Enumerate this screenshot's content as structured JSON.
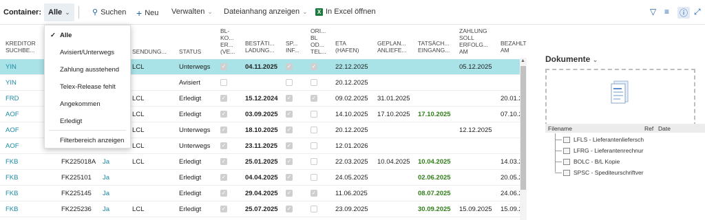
{
  "toolbar": {
    "container_label": "Container:",
    "filter_value": "Alle",
    "search_label": "Suchen",
    "new_label": "Neu",
    "manage_label": "Verwalten",
    "attachment_label": "Dateianhang anzeigen",
    "excel_label": "In Excel öffnen",
    "excel_badge": "X",
    "icons": [
      "filter-icon",
      "list-icon",
      "info-icon",
      "expand-icon"
    ]
  },
  "dropdown": {
    "items": [
      {
        "label": "Alle",
        "checked": true
      },
      {
        "label": "Avisiert/Unterwegs"
      },
      {
        "label": "Zahlung ausstehend"
      },
      {
        "label": "Telex-Release fehlt"
      },
      {
        "label": "Angekommen"
      },
      {
        "label": "Erledigt"
      }
    ],
    "footer": "Filterbereich anzeigen"
  },
  "table": {
    "headers": {
      "kreditor": "KREDITOR\nSUCHBE...",
      "sendung": "SENDUNG...",
      "status": "STATUS",
      "blko": "BL-\nKO...\nER...\n(VE...",
      "bestaet": "BESTÄTI...\nLADUNG...",
      "sp": "SP...\nINF...",
      "ori": "ORI...\nBL\nOD...\nTEL...",
      "eta": "ETA\n(HAFEN)",
      "geplan": "GEPLAN...\nANLIEFE...",
      "tatsaech": "TATSÄCH...\nEINGANG...",
      "zahlung": "ZAHLUNG\nSOLL\nERFOLG...\nAM",
      "bezahlt": "BEZAHLT\nAM"
    },
    "rows": [
      {
        "kreditor": "YIN",
        "ref": "",
        "ja": "",
        "sendung": "LCL",
        "status": "Unterwegs",
        "blko": true,
        "bestaet": "04.11.2025",
        "sp": true,
        "ori": true,
        "eta": "22.12.2025",
        "geplan": "",
        "tatsaech": "",
        "zahlung": "05.12.2025",
        "bezahlt": ""
      },
      {
        "kreditor": "YIN",
        "ref": "",
        "ja": "",
        "sendung": "",
        "status": "Avisiert",
        "blko": false,
        "bestaet": "",
        "sp": false,
        "ori": false,
        "eta": "20.12.2025",
        "geplan": "",
        "tatsaech": "",
        "zahlung": "",
        "bezahlt": ""
      },
      {
        "kreditor": "FRD",
        "ref": "",
        "ja": "",
        "sendung": "LCL",
        "status": "Erledigt",
        "blko": true,
        "bestaet": "15.12.2024",
        "sp": true,
        "ori": true,
        "eta": "09.02.2025",
        "geplan": "31.01.2025",
        "tatsaech": "",
        "zahlung": "",
        "bezahlt": "20.01.2"
      },
      {
        "kreditor": "AOF",
        "ref": "",
        "ja": "",
        "sendung": "LCL",
        "status": "Erledigt",
        "blko": true,
        "bestaet": "03.09.2025",
        "sp": true,
        "ori": false,
        "eta": "14.10.2025",
        "geplan": "17.10.2025",
        "tatsaech": "17.10.2025",
        "zahlung": "",
        "bezahlt": "07.10.2"
      },
      {
        "kreditor": "AOF",
        "ref": "",
        "ja": "",
        "sendung": "LCL",
        "status": "Unterwegs",
        "blko": true,
        "bestaet": "18.10.2025",
        "sp": true,
        "ori": false,
        "eta": "20.12.2025",
        "geplan": "",
        "tatsaech": "",
        "zahlung": "12.12.2025",
        "bezahlt": ""
      },
      {
        "kreditor": "AOF",
        "ref": "",
        "ja": "",
        "sendung": "LCL",
        "status": "Unterwegs",
        "blko": true,
        "bestaet": "23.11.2025",
        "sp": true,
        "ori": false,
        "eta": "12.01.2026",
        "geplan": "",
        "tatsaech": "",
        "zahlung": "",
        "bezahlt": ""
      },
      {
        "kreditor": "FKB",
        "ref": "FK225018A",
        "ja": "Ja",
        "sendung": "LCL",
        "status": "Erledigt",
        "blko": true,
        "bestaet": "25.01.2025",
        "sp": true,
        "ori": false,
        "eta": "22.03.2025",
        "geplan": "10.04.2025",
        "tatsaech": "10.04.2025",
        "zahlung": "",
        "bezahlt": "14.03.2"
      },
      {
        "kreditor": "FKB",
        "ref": "FK225101",
        "ja": "Ja",
        "sendung": "",
        "status": "Erledigt",
        "blko": true,
        "bestaet": "04.04.2025",
        "sp": true,
        "ori": false,
        "eta": "24.05.2025",
        "geplan": "",
        "tatsaech": "02.06.2025",
        "zahlung": "",
        "bezahlt": "20.05.2"
      },
      {
        "kreditor": "FKB",
        "ref": "FK225145",
        "ja": "Ja",
        "sendung": "",
        "status": "Erledigt",
        "blko": true,
        "bestaet": "29.04.2025",
        "sp": true,
        "ori": true,
        "eta": "11.06.2025",
        "geplan": "",
        "tatsaech": "08.07.2025",
        "zahlung": "",
        "bezahlt": "24.06.2"
      },
      {
        "kreditor": "FKB",
        "ref": "FK225236",
        "ja": "Ja",
        "sendung": "LCL",
        "status": "Erledigt",
        "blko": true,
        "bestaet": "25.07.2025",
        "sp": true,
        "ori": false,
        "eta": "23.09.2025",
        "geplan": "",
        "tatsaech": "30.09.2025",
        "zahlung": "15.09.2025",
        "bezahlt": "15.09.2"
      }
    ]
  },
  "panel": {
    "title": "Dokumente",
    "col_filename": "Filename",
    "col_ref": "Ref",
    "col_date": "Date",
    "files": [
      "LFLS - Lieferantenliefersch",
      "LFRG - Lieferantenrechnur",
      "BOLC - B/L Kopie",
      "SPSC - Spediteurschriftver"
    ]
  }
}
